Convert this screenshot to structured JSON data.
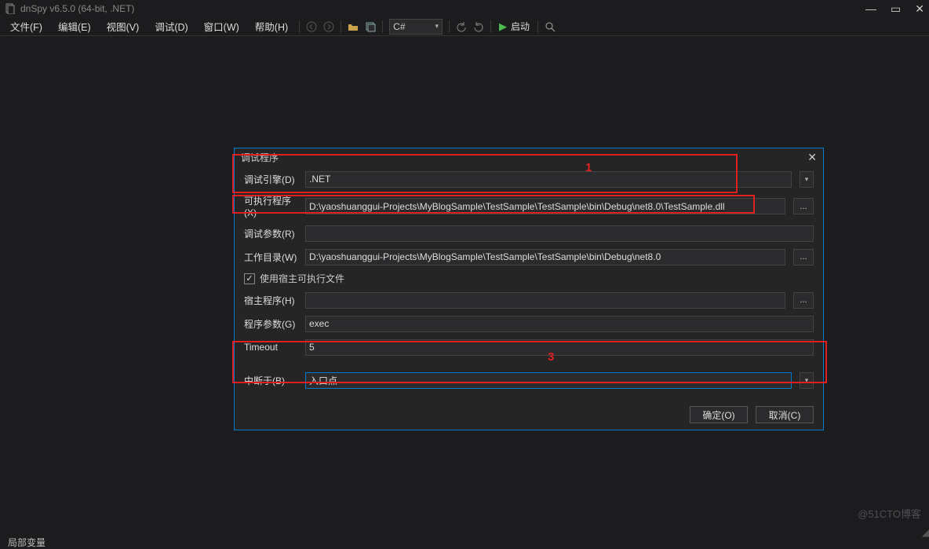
{
  "titlebar": {
    "title": "dnSpy v6.5.0 (64-bit, .NET)"
  },
  "menu": {
    "file": "文件(F)",
    "edit": "编辑(E)",
    "view": "视图(V)",
    "debug": "调试(D)",
    "window": "窗口(W)",
    "help": "帮助(H)"
  },
  "toolbar": {
    "language": "C#",
    "start": "启动"
  },
  "dialog": {
    "title": "调试程序",
    "labels": {
      "engine": "调试引擎(D)",
      "executable": "可执行程序(X)",
      "arguments": "调试参数(R)",
      "workdir": "工作目录(W)",
      "use_host": "使用宿主可执行文件",
      "host_program": "宿主程序(H)",
      "program_args": "程序参数(G)",
      "timeout": "Timeout",
      "break_at": "中断于(B)"
    },
    "values": {
      "engine": ".NET",
      "executable": "D:\\yaoshuanggui-Projects\\MyBlogSample\\TestSample\\TestSample\\bin\\Debug\\net8.0\\TestSample.dll",
      "arguments": "",
      "workdir": "D:\\yaoshuanggui-Projects\\MyBlogSample\\TestSample\\TestSample\\bin\\Debug\\net8.0",
      "use_host_checked": "✓",
      "host_program": "",
      "program_args": "exec",
      "timeout": "5",
      "break_at": "入口点"
    },
    "buttons": {
      "ok": "确定(O)",
      "cancel": "取消(C)",
      "browse": "..."
    }
  },
  "annotations": {
    "box1": "1",
    "box3": "3"
  },
  "bottom": {
    "local_vars": "局部变量"
  },
  "watermark": "@51CTO博客"
}
